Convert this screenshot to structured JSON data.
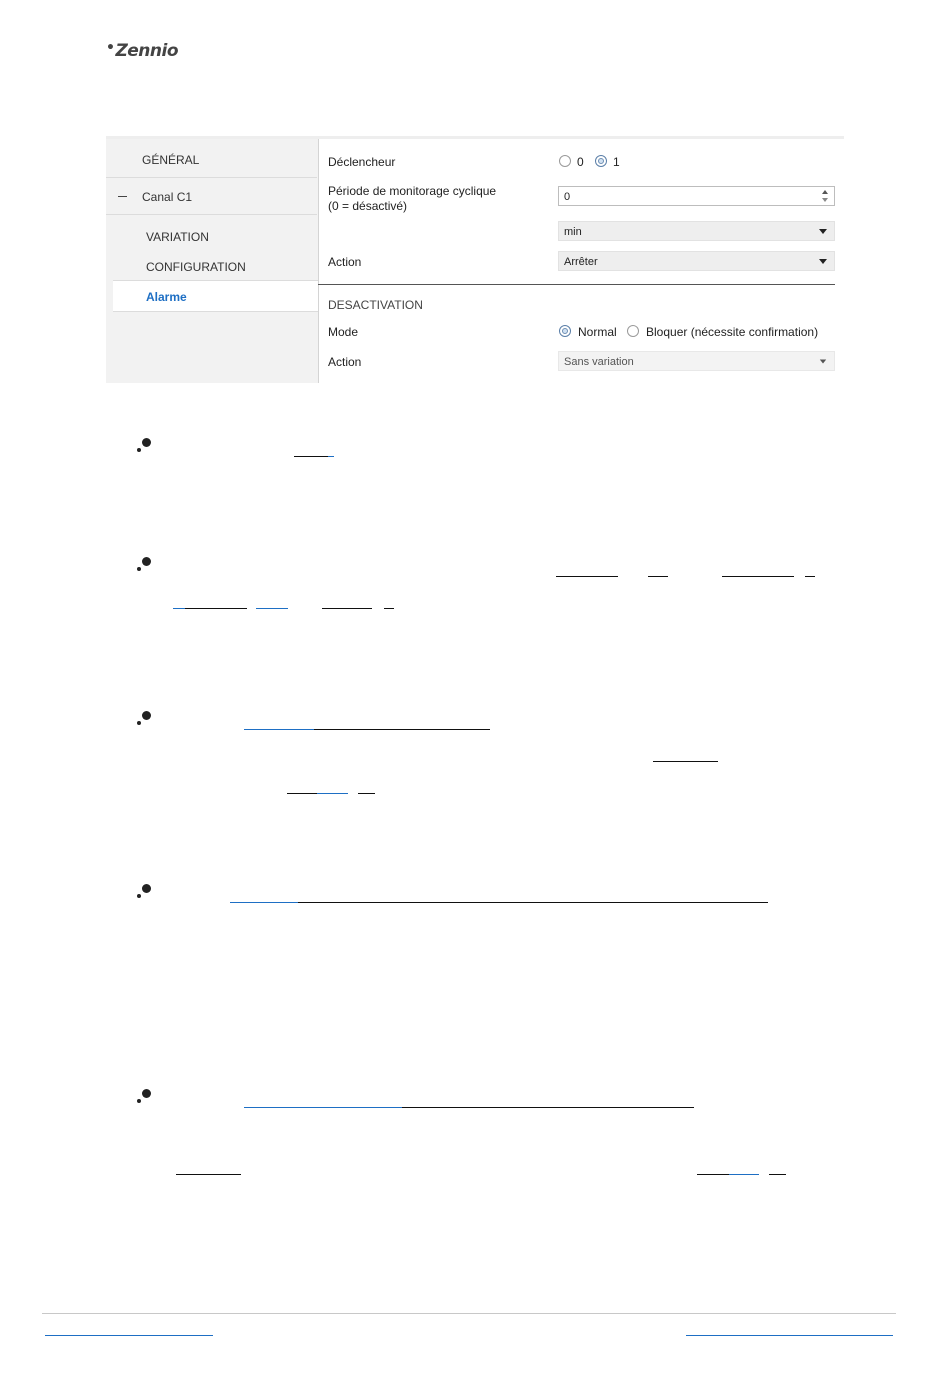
{
  "header": {
    "logo_text": "Zennio",
    "logo_dot": "•"
  },
  "sidebar": {
    "general": "GÉNÉRAL",
    "channel": "Canal C1",
    "subitems": [
      "VARIATION",
      "CONFIGURATION",
      "Alarme"
    ]
  },
  "form": {
    "trigger": {
      "label": "Déclencheur",
      "options": [
        "0",
        "1"
      ],
      "selected": "1"
    },
    "monitoring": {
      "label_line1": "Période de monitorage cyclique",
      "label_line2": "(0 = désactivé)",
      "value": "0",
      "unit": "min"
    },
    "action": {
      "label": "Action",
      "value": "Arrêter"
    },
    "deactivation": {
      "title": "DESACTIVATION",
      "mode_label": "Mode",
      "mode_options": [
        "Normal",
        "Bloquer (nécessite confirmation)"
      ],
      "mode_selected": "Normal",
      "action_label": "Action",
      "action_value": "Sans variation"
    }
  },
  "colors": {
    "accent": "#1e6fc4",
    "sidebar_bg": "#f2f2f2",
    "select_bg": "#eeeeee"
  }
}
